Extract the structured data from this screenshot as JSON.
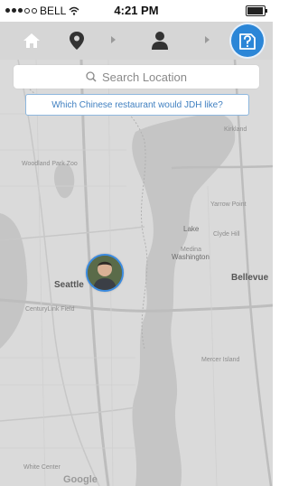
{
  "status_bar": {
    "carrier": "BELL",
    "time": "4:21 PM"
  },
  "nav": {
    "icons": [
      "home-icon",
      "location-pin-icon",
      "chevron-right-icon",
      "person-icon",
      "chevron-right-icon",
      "question-icon"
    ],
    "accent_color": "#2b86d7"
  },
  "search": {
    "placeholder": "Search Location"
  },
  "prompt": {
    "text": "Which Chinese restaurant would JDH like?"
  },
  "map": {
    "labels": {
      "seattle": "Seattle",
      "kirkland": "Kirkland",
      "bellevue": "Bellevue",
      "mercer_island": "Mercer Island",
      "lake": "Lake",
      "washington": "Washington",
      "yarrow_point": "Yarrow Point",
      "clyde_hill": "Clyde Hill",
      "medina": "Medina",
      "centurylink": "CenturyLink Field",
      "woodland": "Woodland Park Zoo",
      "white_center": "White Center",
      "google": "Google"
    }
  }
}
